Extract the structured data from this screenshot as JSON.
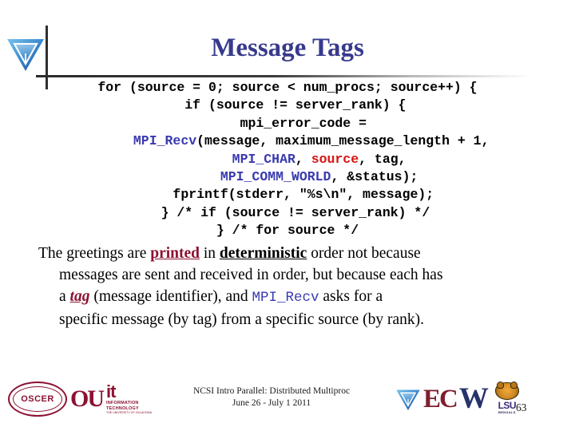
{
  "slide": {
    "title": "Message Tags",
    "page_number": "63"
  },
  "header": {
    "logo_icon": "blue-triangle-logo"
  },
  "code": {
    "lines": [
      [
        {
          "t": "for (source = 0; source < num_procs; source++) {",
          "c": "plain"
        }
      ],
      [
        {
          "t": "  if (source != server_rank) {",
          "c": "plain"
        }
      ],
      [
        {
          "t": "    mpi_error_code =",
          "c": "plain"
        }
      ],
      [
        {
          "t": "      ",
          "c": "plain"
        },
        {
          "t": "MPI_Recv",
          "c": "mpi"
        },
        {
          "t": "(message, maximum_message_length + 1,",
          "c": "plain"
        }
      ],
      [
        {
          "t": "        ",
          "c": "plain"
        },
        {
          "t": "MPI_CHAR",
          "c": "mpi"
        },
        {
          "t": ", ",
          "c": "plain"
        },
        {
          "t": "source",
          "c": "src"
        },
        {
          "t": ", tag,",
          "c": "plain"
        }
      ],
      [
        {
          "t": "        ",
          "c": "plain"
        },
        {
          "t": "MPI_COMM_WORLD",
          "c": "mpi"
        },
        {
          "t": ", &status);",
          "c": "plain"
        }
      ],
      [
        {
          "t": "    fprintf(stderr, \"%s\\n\", message);",
          "c": "plain"
        }
      ],
      [
        {
          "t": "  } /* if (source != server_rank) */",
          "c": "plain"
        }
      ],
      [
        {
          "t": "} /* for source */",
          "c": "plain"
        }
      ]
    ]
  },
  "body": {
    "lines": [
      {
        "indent": false,
        "runs": [
          {
            "t": "The greetings are ",
            "s": "plain"
          },
          {
            "t": "printed",
            "s": "maroon"
          },
          {
            "t": " in ",
            "s": "plain"
          },
          {
            "t": "deterministic",
            "s": "black-bold"
          },
          {
            "t": " order not because",
            "s": "plain"
          }
        ]
      },
      {
        "indent": true,
        "runs": [
          {
            "t": "messages are sent and received in order, but because each has",
            "s": "plain"
          }
        ]
      },
      {
        "indent": true,
        "runs": [
          {
            "t": "a ",
            "s": "plain"
          },
          {
            "t": "tag",
            "s": "maroon-italic"
          },
          {
            "t": " (message identifier), and ",
            "s": "plain"
          },
          {
            "t": "MPI_Recv",
            "s": "mono-blue"
          },
          {
            "t": " asks for a",
            "s": "plain"
          }
        ]
      },
      {
        "indent": true,
        "runs": [
          {
            "t": "specific message (by tag) from a specific source (by rank).",
            "s": "plain"
          }
        ]
      }
    ]
  },
  "footer": {
    "line1": "NCSI Intro Parallel: Distributed Multiproc",
    "line2": "June 26 - July 1 2011",
    "logos_left": [
      {
        "name": "oscer-seal-logo",
        "text": "OSCER"
      },
      {
        "name": "ou-logo",
        "text": "OU"
      },
      {
        "name": "ou-it-logo",
        "text": "it",
        "sub": "INFORMATION",
        "sub_b": "TECHNOLOGY",
        "sub_c": "THE UNIVERSITY OF OKLAHOMA"
      }
    ],
    "logos_right": [
      {
        "name": "blue-triangle-logo"
      },
      {
        "name": "ec-logo",
        "text": "EC"
      },
      {
        "name": "w-logo",
        "text": "W"
      },
      {
        "name": "lsu-tiger-logo",
        "text": "LSU",
        "sub": "BENGALS"
      }
    ]
  },
  "colors": {
    "title": "#373a8c",
    "mpi_identifier": "#3a3ab0",
    "source_keyword": "#d81414",
    "maroon_emphasis": "#8c1232",
    "rule": "#2e2e2e"
  }
}
